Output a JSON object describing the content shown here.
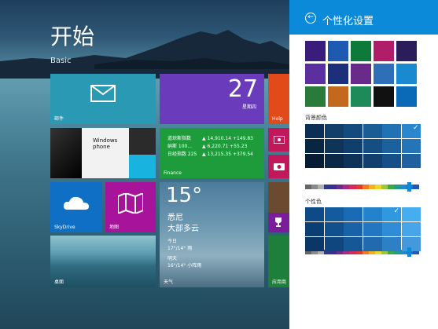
{
  "start": {
    "title": "开始",
    "group": "Basic"
  },
  "tiles": {
    "mail": {
      "label": "邮件",
      "icon": "mail-icon"
    },
    "calendar": {
      "date": "27",
      "weekday": "星期四"
    },
    "help": {
      "label": "Help"
    },
    "news": {
      "brand": "Windows phone"
    },
    "finance": {
      "label": "Finance",
      "rows": [
        {
          "name": "道琼斯指数",
          "value": "▲ 14,910.14 +149.83"
        },
        {
          "name": "纳斯 100...",
          "value": "▲ 6,220.71 +55.23"
        },
        {
          "name": "日经指数 225",
          "value": "▲ 13,215.35 +379.54"
        }
      ]
    },
    "skydrive": {
      "label": "SkyDrive",
      "icon": "cloud-icon"
    },
    "maps": {
      "label": "地图",
      "icon": "map-icon"
    },
    "weather": {
      "temp": "15°",
      "city": "悉尼",
      "condition": "大部多云",
      "today_label": "今日",
      "today": "17°/14° 雨",
      "tomorrow_label": "明天",
      "tomorrow": "16°/14° 小阵雨",
      "label": "天气"
    },
    "desktop": {
      "label": "桌面"
    },
    "store": {
      "label": "应用商"
    }
  },
  "panel": {
    "title": "个性化设置",
    "background_color_label": "背景颜色",
    "accent_color_label": "个性色"
  },
  "colors": {
    "panel_header": "#0a8ad8",
    "background_row1": [
      "#0b2e56",
      "#123e6a",
      "#144b7e",
      "#1a5d95",
      "#1f73b4",
      "#2a86cf"
    ],
    "background_row2": [
      "#082542",
      "#0e3457",
      "#113f6b",
      "#154f82",
      "#1b629d",
      "#2474b8"
    ],
    "background_row3": [
      "#061c33",
      "#0b2946",
      "#0e3358",
      "#123f6d",
      "#175086",
      "#1f61a0"
    ],
    "accent_row1": [
      "#0e4a86",
      "#135a9e",
      "#1a6bb6",
      "#2382cc",
      "#2f98df",
      "#46aef0"
    ],
    "accent_row2": [
      "#0b3f74",
      "#11508d",
      "#1962a7",
      "#2376c0",
      "#2f8cd6",
      "#48a5ea"
    ],
    "accent_row3": [
      "#0a3766",
      "#0f467d",
      "#165795",
      "#206aad",
      "#2c80c6",
      "#4499de"
    ],
    "spectrum": [
      "#666666",
      "#8a8a8a",
      "#b0b0b0",
      "#2d3a8c",
      "#3a2d8c",
      "#6a2d8c",
      "#a02d8c",
      "#d6285c",
      "#e03a2a",
      "#f07a1e",
      "#f5b01e",
      "#e9d92a",
      "#9cc63b",
      "#3aa84a",
      "#1e9b8a",
      "#1e8ad0",
      "#2a6ad6",
      "#1e5ab0"
    ]
  }
}
